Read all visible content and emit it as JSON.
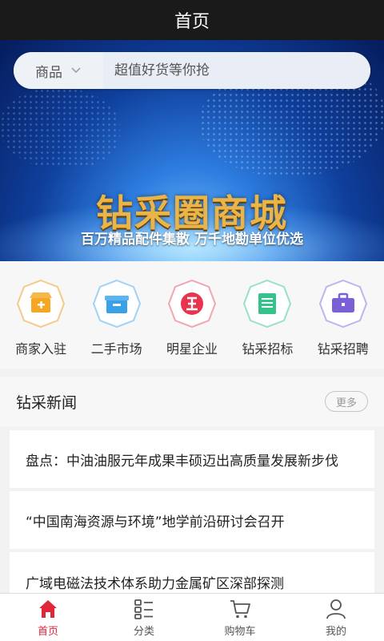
{
  "header": {
    "title": "首页"
  },
  "search": {
    "category": "商品",
    "placeholder": "超值好货等你抢"
  },
  "banner": {
    "title": "钻采圈商城",
    "subtitle": "百万精品配件集散  万千地勘单位优选"
  },
  "quick_links": [
    {
      "label": "商家入驻",
      "icon": "shop-icon",
      "color": "#f5a623"
    },
    {
      "label": "二手市场",
      "icon": "box-icon",
      "color": "#3aa0e8"
    },
    {
      "label": "明星企业",
      "icon": "enterprise-icon",
      "color": "#e9344e"
    },
    {
      "label": "钻采招标",
      "icon": "bidding-icon",
      "color": "#35c28b"
    },
    {
      "label": "钻采招聘",
      "icon": "briefcase-icon",
      "color": "#7b5fd6"
    }
  ],
  "news": {
    "title": "钻采新闻",
    "more_label": "更多",
    "items": [
      "盘点：中油油服元年成果丰硕迈出高质量发展新步伐",
      "“中国南海资源与环境”地学前沿研讨会召开",
      "广域电磁法技术体系助力金属矿区深部探测"
    ]
  },
  "tabbar": {
    "items": [
      {
        "label": "首页",
        "icon": "home-icon",
        "active": true
      },
      {
        "label": "分类",
        "icon": "category-icon",
        "active": false
      },
      {
        "label": "购物车",
        "icon": "cart-icon",
        "active": false
      },
      {
        "label": "我的",
        "icon": "user-icon",
        "active": false
      }
    ]
  },
  "colors": {
    "accent": "#e0263b",
    "titlebar": "#1a1a1a",
    "banner_gold": "#e9b44a"
  }
}
